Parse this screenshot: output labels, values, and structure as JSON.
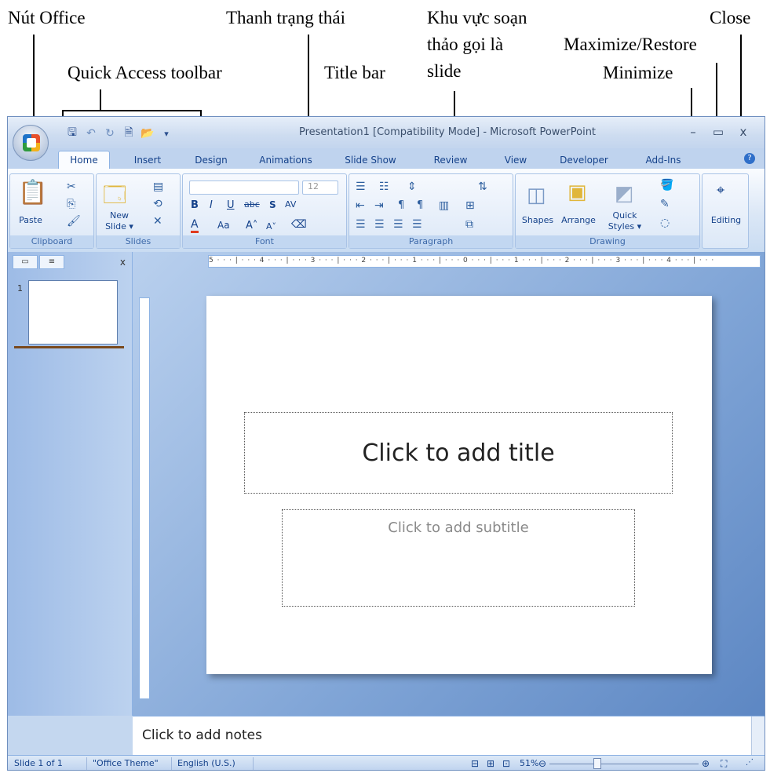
{
  "annotations": {
    "office_button": "Nút Office",
    "status_bar": "Thanh trạng thái",
    "slide_area": "Khu vực soạn thảo gọi là slide",
    "close": "Close",
    "quick_access": "Quick Access toolbar",
    "title_bar": "Title bar",
    "maximize_restore": "Maximize/Restore",
    "minimize": "Minimize"
  },
  "window": {
    "title": "Presentation1 [Compatibility Mode] - Microsoft PowerPoint",
    "min_glyph": "–",
    "max_glyph": "▭",
    "close_glyph": "x"
  },
  "tabs": [
    "Home",
    "Insert",
    "Design",
    "Animations",
    "Slide Show",
    "Review",
    "View",
    "Developer",
    "Add-Ins"
  ],
  "ribbon": {
    "clipboard": {
      "label": "Clipboard",
      "paste": "Paste"
    },
    "slides": {
      "label": "Slides",
      "new_slide_1": "New",
      "new_slide_2": "Slide ▾"
    },
    "font": {
      "label": "Font",
      "size": "12"
    },
    "paragraph": {
      "label": "Paragraph"
    },
    "drawing": {
      "label": "Drawing",
      "shapes": "Shapes",
      "arrange": "Arrange",
      "quick_1": "Quick",
      "quick_2": "Styles ▾"
    },
    "editing": {
      "label": "Editing"
    }
  },
  "left_pane": {
    "slide_number": "1",
    "close": "x"
  },
  "ruler": {
    "h_ticks": "5 · · · | · · · 4 · · · | · · · 3 · · · | · · · 2 · · · | · · · 1 · · · | · · · 0 · · · | · · · 1 · · · | · · · 2 · · · | · · · 3 · · · | · · · 4 · · · | · · ·"
  },
  "slide": {
    "title_placeholder": "Click to add title",
    "subtitle_placeholder": "Click to add subtitle"
  },
  "notes": {
    "placeholder": "Click to add notes"
  },
  "status": {
    "slide": "Slide 1 of 1",
    "theme": "\"Office Theme\"",
    "language": "English (U.S.)",
    "zoom": "51%"
  }
}
